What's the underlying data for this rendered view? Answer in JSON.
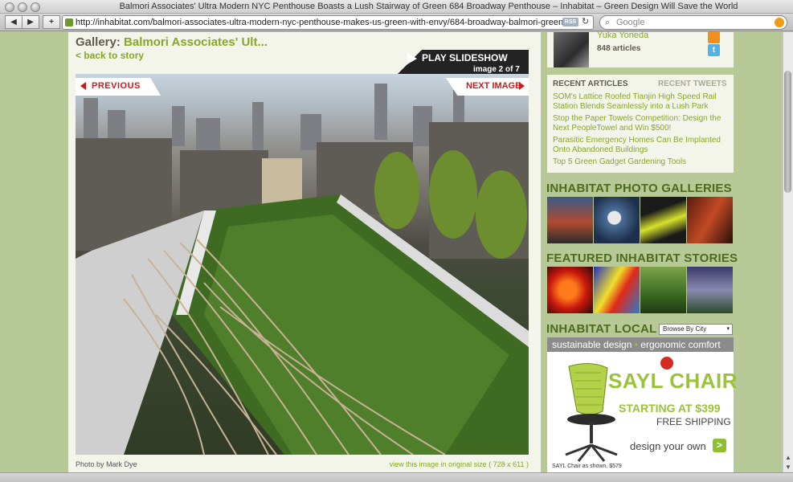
{
  "browser": {
    "window_title": "Balmori Associates' Ultra Modern NYC Penthouse Boasts a Lush Stairway of Green 684 Broadway Penthouse – Inhabitat – Green Design Will Save the World",
    "url": "http://inhabitat.com/balmori-associates-ultra-modern-nyc-penthouse-makes-us-green-with-envy/684-broadway-balmori-green",
    "rss_badge": "RSS",
    "search_placeholder": "Google",
    "back_icon": "◀",
    "forward_icon": "▶",
    "add_icon": "+",
    "reload_icon": "↻"
  },
  "gallery": {
    "title_prefix": "Gallery:",
    "title": "Balmori Associates' Ult...",
    "back_link": "< back to story",
    "slideshow_label": "PLAY SLIDESHOW",
    "image_counter": "image 2 of 7",
    "previous_label": "PREVIOUS",
    "next_label": "NEXT IMAGE",
    "photo_credit": "Photo by Mark Dye",
    "original_size_link": "view this image in original size ( 728 x 611 )"
  },
  "sidebar": {
    "author": {
      "name": "Yuka Yoneda",
      "article_count": "848 articles"
    },
    "tabs": {
      "articles": "RECENT ARTICLES",
      "tweets": "RECENT TWEETS"
    },
    "articles": [
      "SOM's Lattice Roofed Tianjin High Speed Rail Station Blends Seamlessly into a Lush Park",
      "Stop the Paper Towels Competition: Design the Next PeopleTowel and Win $500!",
      "Parasitic Emergency Homes Can Be Implanted Onto Abandoned Buildings",
      "Top 5 Green Gadget Gardening Tools"
    ],
    "photo_galleries_heading": "INHABITAT PHOTO GALLERIES",
    "featured_stories_heading": "FEATURED INHABITAT STORIES",
    "local_heading": "INHABITAT LOCAL",
    "browse_by_city": "Browse By City"
  },
  "ad": {
    "strip_left": "sustainable design",
    "strip_dot": "•",
    "strip_right": "ergonomic comfort",
    "title": "SAYL CHAIR",
    "price": "STARTING AT $399",
    "shipping": "FREE SHIPPING",
    "cta": "design your own",
    "cta_arrow": ">",
    "caption": "SAYL Chair as shown, $579"
  },
  "colors": {
    "accent_green": "#86a728",
    "heading_green": "#4e6b1d",
    "alert_red": "#c91b1b"
  }
}
